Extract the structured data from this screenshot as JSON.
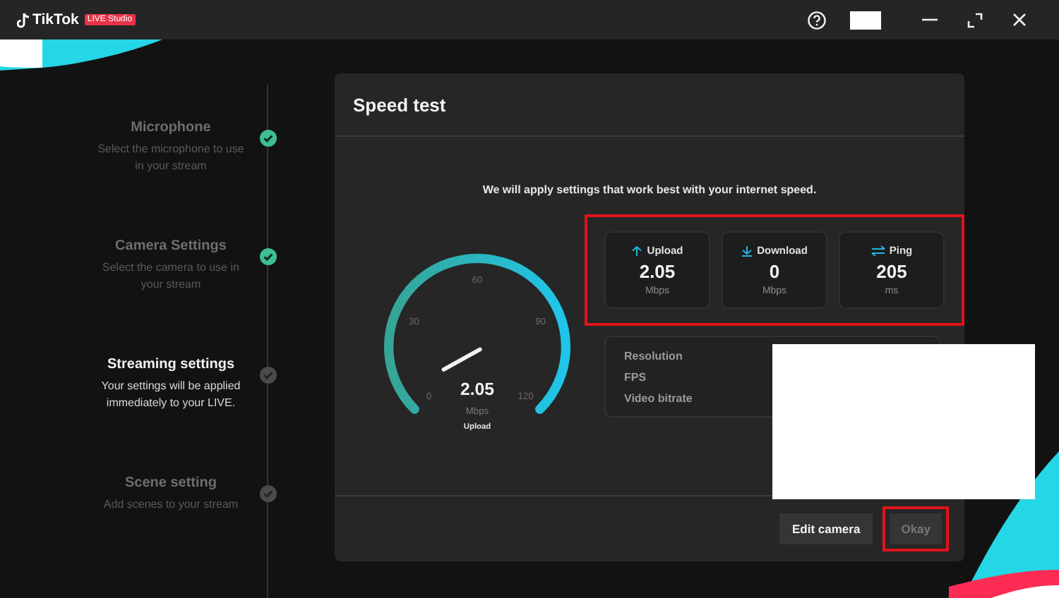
{
  "title_bar": {
    "app_name": "TikTok",
    "badge": "LIVE Studio"
  },
  "steps": [
    {
      "title": "Microphone",
      "description": "Select the microphone to use in your stream",
      "done": true,
      "selected": false
    },
    {
      "title": "Camera Settings",
      "description": "Select the camera to use in your stream",
      "done": true,
      "selected": false
    },
    {
      "title": "Streaming settings",
      "description": "Your settings will be applied immediately to your LIVE.",
      "done": false,
      "selected": true
    },
    {
      "title": "Scene setting",
      "description": "Add scenes to your stream",
      "done": false,
      "selected": false
    }
  ],
  "dialog": {
    "title": "Speed test",
    "intro": "We will apply settings that work best with your internet speed.",
    "gauge": {
      "ticks": [
        "0",
        "30",
        "60",
        "90",
        "120"
      ],
      "value": "2.05",
      "unit": "Mbps",
      "label": "Upload"
    },
    "stats_highlighted": true,
    "stats": [
      {
        "kind": "upload",
        "label": "Upload",
        "value": "2.05",
        "unit": "Mbps"
      },
      {
        "kind": "download",
        "label": "Download",
        "value": "0",
        "unit": "Mbps"
      },
      {
        "kind": "ping",
        "label": "Ping",
        "value": "205",
        "unit": "ms"
      }
    ],
    "settings": [
      "Resolution",
      "FPS",
      "Video bitrate"
    ],
    "buttons": [
      {
        "label": "Edit camera",
        "disabled": false,
        "highlighted": false
      },
      {
        "label": "Okay",
        "disabled": true,
        "highlighted": true
      }
    ]
  }
}
